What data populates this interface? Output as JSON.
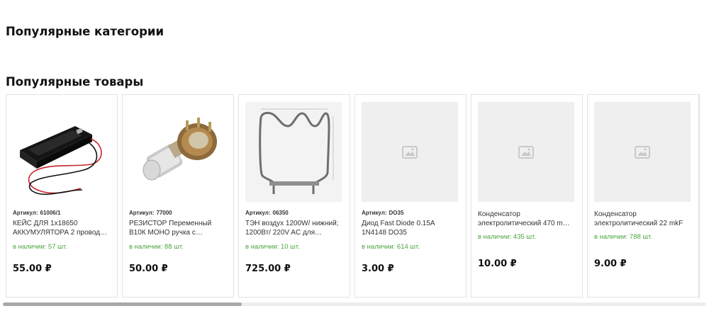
{
  "sections": {
    "categories_title": "Популярные категории",
    "products_title": "Популярные товары"
  },
  "product_labels": {
    "sku_label": "Артикул:",
    "currency": "₽"
  },
  "products": [
    {
      "sku": "61006/1",
      "name": "КЕЙС ДЛЯ 1x18650 АККУМУЛЯТОРА 2 провод…",
      "stock": "в наличии: 57 шт.",
      "price": "55.00 ₽",
      "image": "battery-holder-photo"
    },
    {
      "sku": "77000",
      "name": "РЕЗИСТОР Переменный В10К МОНО ручка с…",
      "stock": "в наличии: 88 шт.",
      "price": "50.00 ₽",
      "image": "potentiometer-photo"
    },
    {
      "sku": "06350",
      "name": "ТЭН воздух 1200W/ нижний; 1200Вт/ 220V AC для…",
      "stock": "в наличии: 10 шт.",
      "price": "725.00 ₽",
      "image": "heating-element-photo"
    },
    {
      "sku": "DO35",
      "name": "Диод Fast Diode 0.15A 1N4148 DO35",
      "stock": "в наличии: 614 шт.",
      "price": "3.00 ₽",
      "image": "image-placeholder-icon"
    },
    {
      "sku": null,
      "name": "Конденсатор электролитический 470 m…",
      "stock": "в наличии: 435 шт.",
      "price": "10.00 ₽",
      "image": "image-placeholder-icon"
    },
    {
      "sku": null,
      "name": "Конденсатор электролитический 22 mkF",
      "stock": "в наличии: 788 шт.",
      "price": "9.00 ₽",
      "image": "image-placeholder-icon"
    }
  ],
  "carousel": {
    "scroll_position": 0.34
  },
  "colors": {
    "stock_green": "#4aa63e",
    "border": "#e3e3e3",
    "placeholder_bg": "#efefef"
  }
}
